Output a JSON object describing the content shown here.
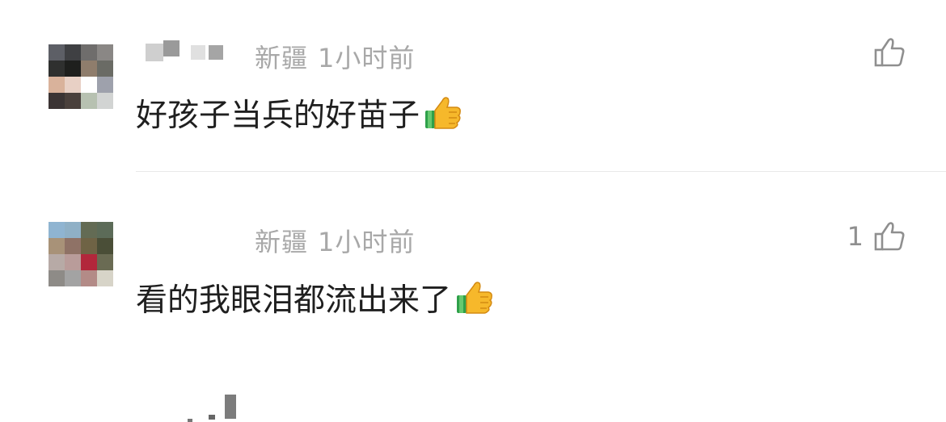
{
  "comments": [
    {
      "location": "新疆",
      "time": "1小时前",
      "text": "好孩子当兵的好苗子",
      "emoji": "thumbs-up-emoji",
      "like_count": "",
      "like_icon": "thumbs-up-outline-icon",
      "avatar_colors": [
        "#5d5f66",
        "#3f4043",
        "#6f6d6c",
        "#8a8785",
        "#2f302f",
        "#1e1f1d",
        "#8f7d6c",
        "#6a6b65",
        "#d9b29b",
        "#e8d0c5",
        "#ffffff",
        "#9ea1ac",
        "#3b3434",
        "#4a403c",
        "#b7c1b1",
        "#d2d4d3"
      ]
    },
    {
      "location": "新疆",
      "time": "1小时前",
      "text": "看的我眼泪都流出来了",
      "emoji": "thumbs-up-emoji",
      "like_count": "1",
      "like_icon": "thumbs-up-outline-icon",
      "avatar_colors": [
        "#8fb4d1",
        "#8fb0c6",
        "#636b54",
        "#5c6b58",
        "#a89278",
        "#8f7266",
        "#6f6345",
        "#4a4e37",
        "#b7aaa6",
        "#b99c9a",
        "#b2273b",
        "#6a6b53",
        "#8e8b87",
        "#a3a3a3",
        "#b38b87",
        "#d7d4c8"
      ]
    }
  ]
}
